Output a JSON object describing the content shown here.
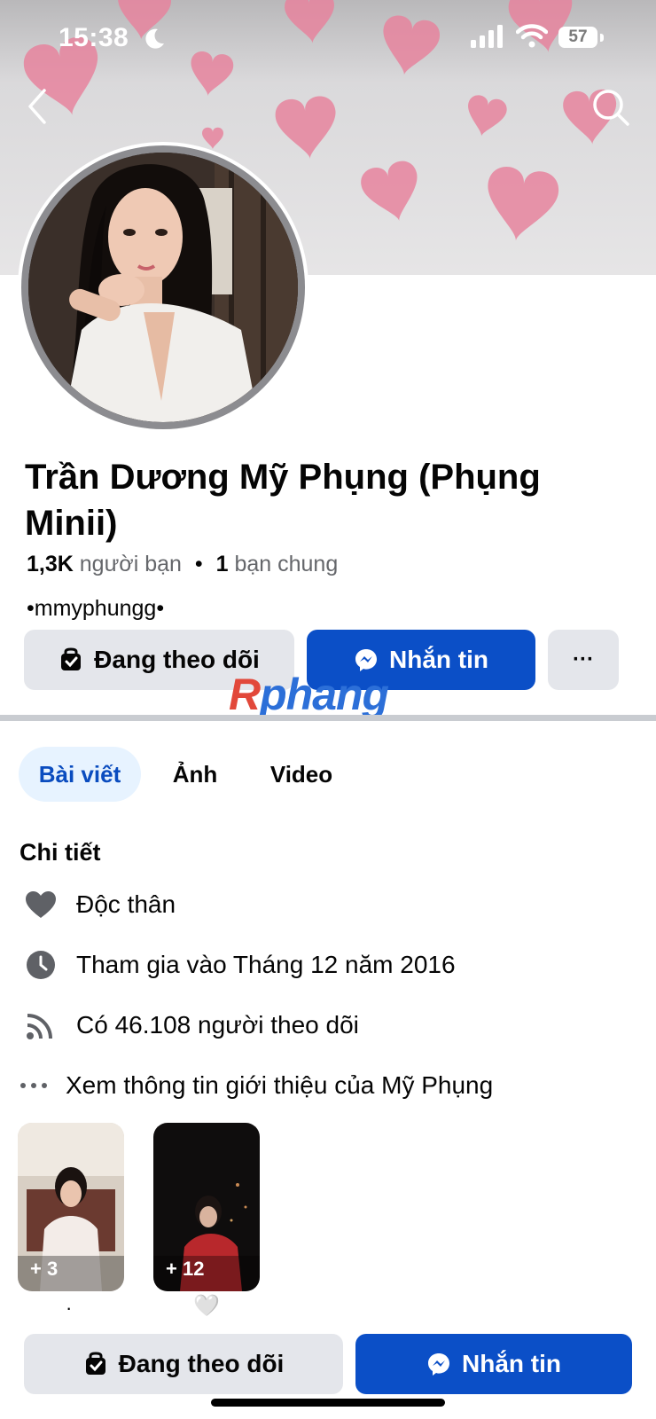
{
  "status_bar": {
    "time": "15:38",
    "battery": "57"
  },
  "profile": {
    "name": "Trần Dương Mỹ Phụng (Phụng Minii)",
    "friends_count": "1,3K",
    "friends_label": "người bạn",
    "mutual_count": "1",
    "mutual_label": "bạn chung",
    "bio": "•mmyphungg•"
  },
  "actions": {
    "following_label": "Đang theo dõi",
    "message_label": "Nhắn tin",
    "more_label": "···"
  },
  "watermark": {
    "first": "R",
    "rest": "phang"
  },
  "tabs": [
    {
      "label": "Bài viết",
      "active": true
    },
    {
      "label": "Ảnh",
      "active": false
    },
    {
      "label": "Video",
      "active": false
    }
  ],
  "details": {
    "title": "Chi tiết",
    "items": [
      {
        "icon": "heart-icon",
        "text": "Độc thân"
      },
      {
        "icon": "clock-icon",
        "text": "Tham gia vào Tháng 12 năm 2016"
      },
      {
        "icon": "rss-icon",
        "text": "Có 46.108 người theo dõi"
      },
      {
        "icon": "more-icon",
        "text": "Xem thông tin giới thiệu của Mỹ Phụng"
      }
    ]
  },
  "stories": [
    {
      "count": "+ 3",
      "caption": "·"
    },
    {
      "count": "+ 12",
      "caption": "🤍"
    }
  ],
  "bottom_bar": {
    "following_label": "Đang theo dõi",
    "message_label": "Nhắn tin"
  },
  "colors": {
    "accent_blue": "#0b4fc7",
    "tab_active_bg": "#e7f3ff",
    "button_gray": "#e4e6eb",
    "heart_pink": "#e7849e"
  }
}
